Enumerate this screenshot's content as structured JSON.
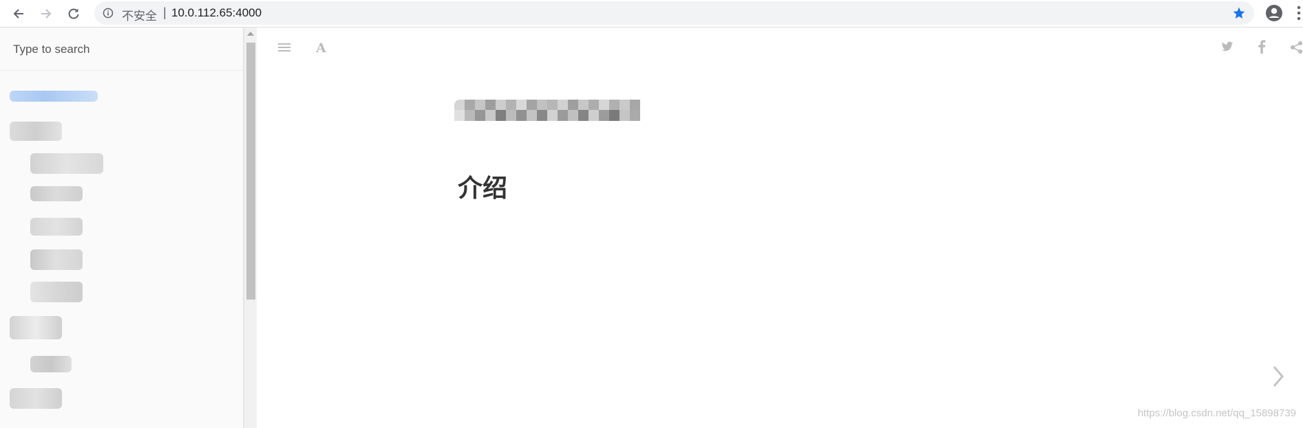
{
  "browser": {
    "security_label": "不安全",
    "separator": "|",
    "url": "10.0.112.65:4000",
    "bookmark_color": "#1a73e8",
    "icons": [
      "back-arrow-icon",
      "forward-arrow-icon",
      "reload-icon",
      "info-icon",
      "star-icon",
      "profile-icon",
      "kebab-menu-icon"
    ]
  },
  "sidebar": {
    "search_placeholder": "Type to search",
    "items_note_redacted": true
  },
  "toolbar": {
    "icons": [
      "toc-menu-icon",
      "font-settings-icon",
      "twitter-icon",
      "facebook-icon",
      "share-icon"
    ]
  },
  "page": {
    "heading": "介绍",
    "watermark": "https://blog.csdn.net/qq_15898739"
  }
}
